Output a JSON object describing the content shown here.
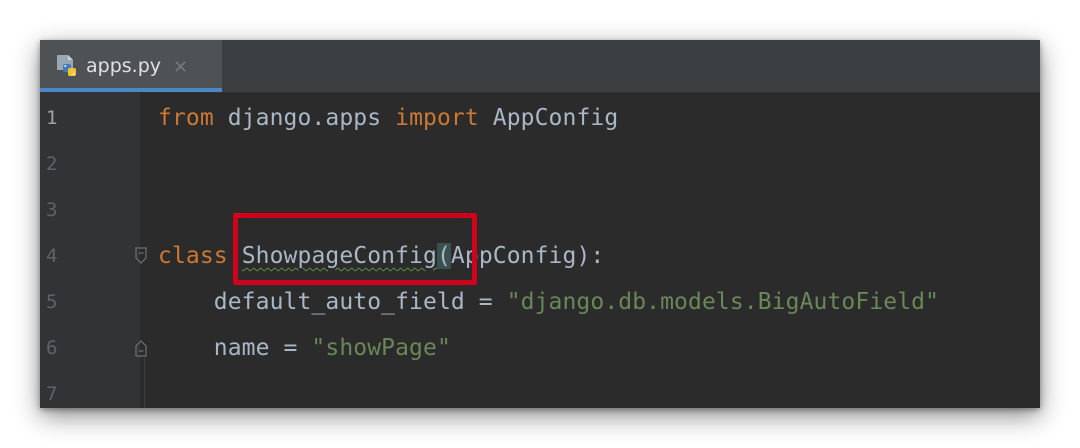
{
  "tab": {
    "filename": "apps.py",
    "close_glyph": "×",
    "icon": "python-file-icon"
  },
  "editor": {
    "lines": [
      {
        "num": "1",
        "tokens": [
          [
            "kw",
            "from"
          ],
          [
            "plain",
            " django.apps "
          ],
          [
            "kw",
            "import"
          ],
          [
            "plain",
            " AppConfig"
          ]
        ]
      },
      {
        "num": "2",
        "tokens": []
      },
      {
        "num": "3",
        "tokens": []
      },
      {
        "num": "4",
        "tokens": [
          [
            "kw",
            "class"
          ],
          [
            "plain",
            " "
          ],
          [
            "cls",
            "ShowpageConfig"
          ],
          [
            "paren",
            "("
          ],
          [
            "plain",
            "AppConfig):"
          ]
        ]
      },
      {
        "num": "5",
        "tokens": [
          [
            "plain",
            "    default_auto_field = "
          ],
          [
            "str",
            "\"django.db.models.BigAutoField\""
          ]
        ]
      },
      {
        "num": "6",
        "tokens": [
          [
            "plain",
            "    name = "
          ],
          [
            "str",
            "\"showPage\""
          ]
        ]
      },
      {
        "num": "7",
        "tokens": []
      }
    ]
  },
  "colors": {
    "keyword": "#cc7832",
    "string": "#6a8759",
    "text": "#a9b7c6",
    "highlight_box": "#d0021b",
    "tab_underline": "#4a88c7"
  }
}
